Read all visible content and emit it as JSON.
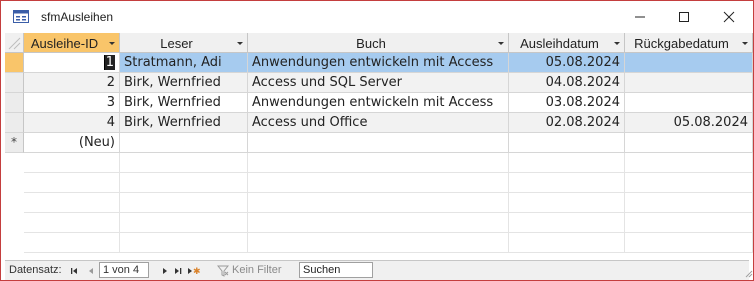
{
  "window": {
    "title": "sfmAusleihen"
  },
  "columns": [
    {
      "label": "Ausleihe-ID"
    },
    {
      "label": "Leser"
    },
    {
      "label": "Buch"
    },
    {
      "label": "Ausleihdatum"
    },
    {
      "label": "Rückgabedatum"
    }
  ],
  "rows": [
    {
      "id": "1",
      "leser": "Stratmann, Adi",
      "buch": "Anwendungen entwickeln mit Access",
      "ausleihdatum": "05.08.2024",
      "rueckgabedatum": ""
    },
    {
      "id": "2",
      "leser": "Birk, Wernfried",
      "buch": "Access und SQL Server",
      "ausleihdatum": "04.08.2024",
      "rueckgabedatum": ""
    },
    {
      "id": "3",
      "leser": "Birk, Wernfried",
      "buch": "Anwendungen entwickeln mit Access",
      "ausleihdatum": "03.08.2024",
      "rueckgabedatum": ""
    },
    {
      "id": "4",
      "leser": "Birk, Wernfried",
      "buch": "Access und Office",
      "ausleihdatum": "02.08.2024",
      "rueckgabedatum": "05.08.2024"
    }
  ],
  "new_row": {
    "marker": "*",
    "id": "(Neu)"
  },
  "nav": {
    "label": "Datensatz:",
    "position": "1 von 4",
    "filter": "Kein Filter",
    "search": "Suchen"
  },
  "colors": {
    "accent": "#f9c56a",
    "selection": "#a6cbef",
    "window_border": "#c43e3e"
  }
}
